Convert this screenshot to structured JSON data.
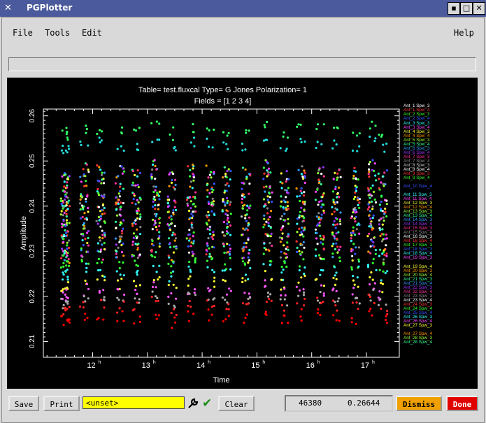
{
  "window": {
    "title": "PGPlotter",
    "app_icon": "x-icon"
  },
  "menu": {
    "file": "File",
    "tools": "Tools",
    "edit": "Edit",
    "help": "Help"
  },
  "plot": {
    "title_line1": "Table= test.fluxcal    Type= G Jones    Polarization= 1",
    "title_line2": "Fields = [1 2 3 4]",
    "xlabel": "Time",
    "ylabel": "Amplitude",
    "yticks": [
      "0.21",
      "0.22",
      "0.23",
      "0.24",
      "0.25",
      "0.26"
    ],
    "xticks": [
      "12",
      "13",
      "14",
      "15",
      "16",
      "17"
    ],
    "xtick_suffix": "h"
  },
  "chart_data": {
    "type": "scatter",
    "title": "Table= test.fluxcal    Type= G Jones    Polarization= 1",
    "subtitle": "Fields = [1 2 3 4]",
    "xlabel": "Time",
    "ylabel": "Amplitude",
    "xlim": [
      11.1,
      17.6
    ],
    "ylim": [
      0.2065,
      0.2615
    ],
    "x_unit": "h",
    "grid": false,
    "legend_position": "right",
    "scan_times": [
      11.5,
      11.85,
      12.15,
      12.5,
      12.8,
      13.15,
      13.45,
      13.8,
      14.15,
      14.45,
      14.8,
      15.2,
      15.5,
      15.8,
      16.15,
      16.45,
      16.8,
      17.1,
      17.3
    ],
    "groups": [
      {
        "center": 0.257,
        "color": "#33ff66"
      },
      {
        "center": 0.2535,
        "color": "#22dddd"
      },
      {
        "center": 0.2478,
        "color": "#33ff33"
      },
      {
        "center": 0.2455,
        "color": "#2233ff"
      },
      {
        "center": 0.2425,
        "color": "#ff33ff"
      },
      {
        "center": 0.241,
        "color": "#ffff00"
      },
      {
        "center": 0.2395,
        "color": "#ff6600"
      },
      {
        "center": 0.2375,
        "color": "#33ffaa"
      },
      {
        "center": 0.2355,
        "color": "#ff3333"
      },
      {
        "center": 0.2335,
        "color": "#aa66ff"
      },
      {
        "center": 0.2315,
        "color": "#ffffff"
      },
      {
        "center": 0.2295,
        "color": "#4466ff"
      },
      {
        "center": 0.2275,
        "color": "#33ff33"
      },
      {
        "center": 0.2255,
        "color": "#33ffff"
      },
      {
        "center": 0.2232,
        "color": "#ffff33"
      },
      {
        "center": 0.2212,
        "color": "#ff55ff"
      },
      {
        "center": 0.2195,
        "color": "#aaaaaa"
      },
      {
        "center": 0.218,
        "color": "#ff2222"
      },
      {
        "center": 0.2155,
        "color": "#ff0000"
      }
    ],
    "legend": [
      {
        "label": "Ant_1 Spw_3",
        "color": "#ffffff"
      },
      {
        "label": "Ant_1 Spw_4",
        "color": "#ff3333"
      },
      {
        "label": "Ant_2 Spw_3",
        "color": "#33ff33"
      },
      {
        "label": "Ant_2 Spw_4",
        "color": "#3355ff"
      },
      {
        "label": "Ant_3 Spw_3",
        "color": "#33ffff"
      },
      {
        "label": "Ant_3 Spw_4",
        "color": "#ff44ff"
      },
      {
        "label": "Ant_4 Spw_3",
        "color": "#ffff33"
      },
      {
        "label": "Ant_4 Spw_4",
        "color": "#ff9900"
      },
      {
        "label": "Ant_5 Spw_3",
        "color": "#99ff33"
      },
      {
        "label": "Ant_5 Spw_4",
        "color": "#33ff99"
      },
      {
        "label": "Ant_6 Spw_3",
        "color": "#3399ff"
      },
      {
        "label": "Ant_6 Spw_4",
        "color": "#9933ff"
      },
      {
        "label": "Ant_7 Spw_3",
        "color": "#ff3399"
      },
      {
        "label": "Ant_7 Spw_4",
        "color": "#888888"
      },
      {
        "label": "Ant_8 Spw_3",
        "color": "#cccccc"
      },
      {
        "label": "Ant_8 Spw_4",
        "color": "#ffffff"
      },
      {
        "label": "Ant_9 Spw_3",
        "color": "#ff3333"
      },
      {
        "label": "Ant_9 Spw_4",
        "color": "#33ff33"
      },
      {
        "label": "Ant_10 Spw_4",
        "color": "#3355ff"
      },
      {
        "label": "Ant_11 Spw_3",
        "color": "#33ffff"
      },
      {
        "label": "Ant_11 Spw_4",
        "color": "#ff44ff"
      },
      {
        "label": "Ant_12 Spw_3",
        "color": "#ffff33"
      },
      {
        "label": "Ant_12 Spw_4",
        "color": "#ff9900"
      },
      {
        "label": "Ant_13 Spw_3",
        "color": "#99ff33"
      },
      {
        "label": "Ant_13 Spw_4",
        "color": "#33ff99"
      },
      {
        "label": "Ant_14 Spw_3",
        "color": "#3399ff"
      },
      {
        "label": "Ant_14 Spw_4",
        "color": "#9933ff"
      },
      {
        "label": "Ant_15 Spw_3",
        "color": "#ff3399"
      },
      {
        "label": "Ant_15 Spw_4",
        "color": "#888888"
      },
      {
        "label": "Ant_16 Spw_3",
        "color": "#ffffff"
      },
      {
        "label": "Ant_16 Spw_4",
        "color": "#ff3333"
      },
      {
        "label": "Ant_17 Spw_3",
        "color": "#33ff33"
      },
      {
        "label": "Ant_18 Spw_3",
        "color": "#3355ff"
      },
      {
        "label": "Ant_18 Spw_4",
        "color": "#33ffff"
      },
      {
        "label": "Ant_19 Spw_3",
        "color": "#ff44ff"
      },
      {
        "label": "Ant_19 Spw_4",
        "color": "#ffff33"
      },
      {
        "label": "Ant_20 Spw_3",
        "color": "#ff9900"
      },
      {
        "label": "Ant_20 Spw_4",
        "color": "#99ff33"
      },
      {
        "label": "Ant_21 Spw_3",
        "color": "#33ff99"
      },
      {
        "label": "Ant_21 Spw_4",
        "color": "#3399ff"
      },
      {
        "label": "Ant_22 Spw_3",
        "color": "#9933ff"
      },
      {
        "label": "Ant_22 Spw_4",
        "color": "#ff3399"
      },
      {
        "label": "Ant_23 Spw_3",
        "color": "#888888"
      },
      {
        "label": "Ant_23 Spw_4",
        "color": "#ffffff"
      },
      {
        "label": "Ant_24 Spw_3",
        "color": "#ff3333"
      },
      {
        "label": "Ant_24 Spw_4",
        "color": "#33ff33"
      },
      {
        "label": "Ant_25 Spw_4",
        "color": "#3355ff"
      },
      {
        "label": "Ant_26 Spw_3",
        "color": "#33ffff"
      },
      {
        "label": "Ant_26 Spw_4",
        "color": "#ff44ff"
      },
      {
        "label": "Ant_27 Spw_3",
        "color": "#ffff33"
      },
      {
        "label": "Ant_27 Spw_4",
        "color": "#ff9900"
      },
      {
        "label": "Ant_28 Spw_3",
        "color": "#99ff33"
      },
      {
        "label": "Ant_28 Spw_4",
        "color": "#33ff99"
      }
    ]
  },
  "toolbar": {
    "save": "Save",
    "print": "Print",
    "input_value": "<unset>",
    "clear": "Clear",
    "coord_x": "46380",
    "coord_y": "0.26644",
    "dismiss": "Dismiss",
    "done": "Done"
  },
  "colors": {
    "dismiss": "#f0a000",
    "done": "#e00000",
    "input": "#ffff00",
    "titlebar": "#4a5a9c"
  }
}
